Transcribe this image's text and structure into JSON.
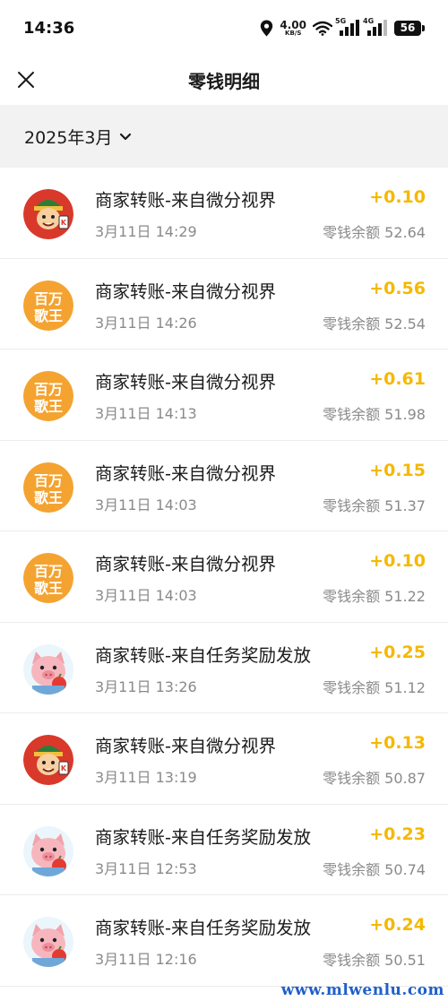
{
  "status_bar": {
    "time": "14:36",
    "net_speed_value": "4.00",
    "net_speed_unit": "KB/S",
    "sig1_label": "5G",
    "sig2_label": "4G",
    "battery": "56",
    "icons": [
      "location-icon",
      "wifi-icon",
      "signal-icon",
      "battery-icon"
    ]
  },
  "header": {
    "title": "零钱明细",
    "close_icon": "close-icon"
  },
  "filter": {
    "month": "2025年3月",
    "icon": "chevron-down-icon"
  },
  "colors": {
    "amount": "#f5b800",
    "secondary_text": "#8a8a8a",
    "section_bg": "#f2f2f2",
    "watermark": "#1f5fc9"
  },
  "transactions": [
    {
      "avatar": "cartoon-character",
      "title": "商家转账-来自微分视界",
      "time": "3月11日 14:29",
      "amount": "+0.10",
      "balance": "零钱余额 52.64"
    },
    {
      "avatar": "baiwan-gewang",
      "avatar_text_1": "百万",
      "avatar_text_2": "歌王",
      "title": "商家转账-来自微分视界",
      "time": "3月11日 14:26",
      "amount": "+0.56",
      "balance": "零钱余额 52.54"
    },
    {
      "avatar": "baiwan-gewang",
      "avatar_text_1": "百万",
      "avatar_text_2": "歌王",
      "title": "商家转账-来自微分视界",
      "time": "3月11日 14:13",
      "amount": "+0.61",
      "balance": "零钱余额 51.98"
    },
    {
      "avatar": "baiwan-gewang",
      "avatar_text_1": "百万",
      "avatar_text_2": "歌王",
      "title": "商家转账-来自微分视界",
      "time": "3月11日 14:03",
      "amount": "+0.15",
      "balance": "零钱余额 51.37"
    },
    {
      "avatar": "baiwan-gewang",
      "avatar_text_1": "百万",
      "avatar_text_2": "歌王",
      "title": "商家转账-来自微分视界",
      "time": "3月11日 14:03",
      "amount": "+0.10",
      "balance": "零钱余额 51.22"
    },
    {
      "avatar": "pig",
      "title": "商家转账-来自任务奖励发放",
      "time": "3月11日 13:26",
      "amount": "+0.25",
      "balance": "零钱余额 51.12"
    },
    {
      "avatar": "cartoon-character",
      "title": "商家转账-来自微分视界",
      "time": "3月11日 13:19",
      "amount": "+0.13",
      "balance": "零钱余额 50.87"
    },
    {
      "avatar": "pig",
      "title": "商家转账-来自任务奖励发放",
      "time": "3月11日 12:53",
      "amount": "+0.23",
      "balance": "零钱余额 50.74"
    },
    {
      "avatar": "pig",
      "title": "商家转账-来自任务奖励发放",
      "time": "3月11日 12:16",
      "amount": "+0.24",
      "balance": "零钱余额 50.51"
    }
  ],
  "watermark": "www.mlwenlu.com"
}
